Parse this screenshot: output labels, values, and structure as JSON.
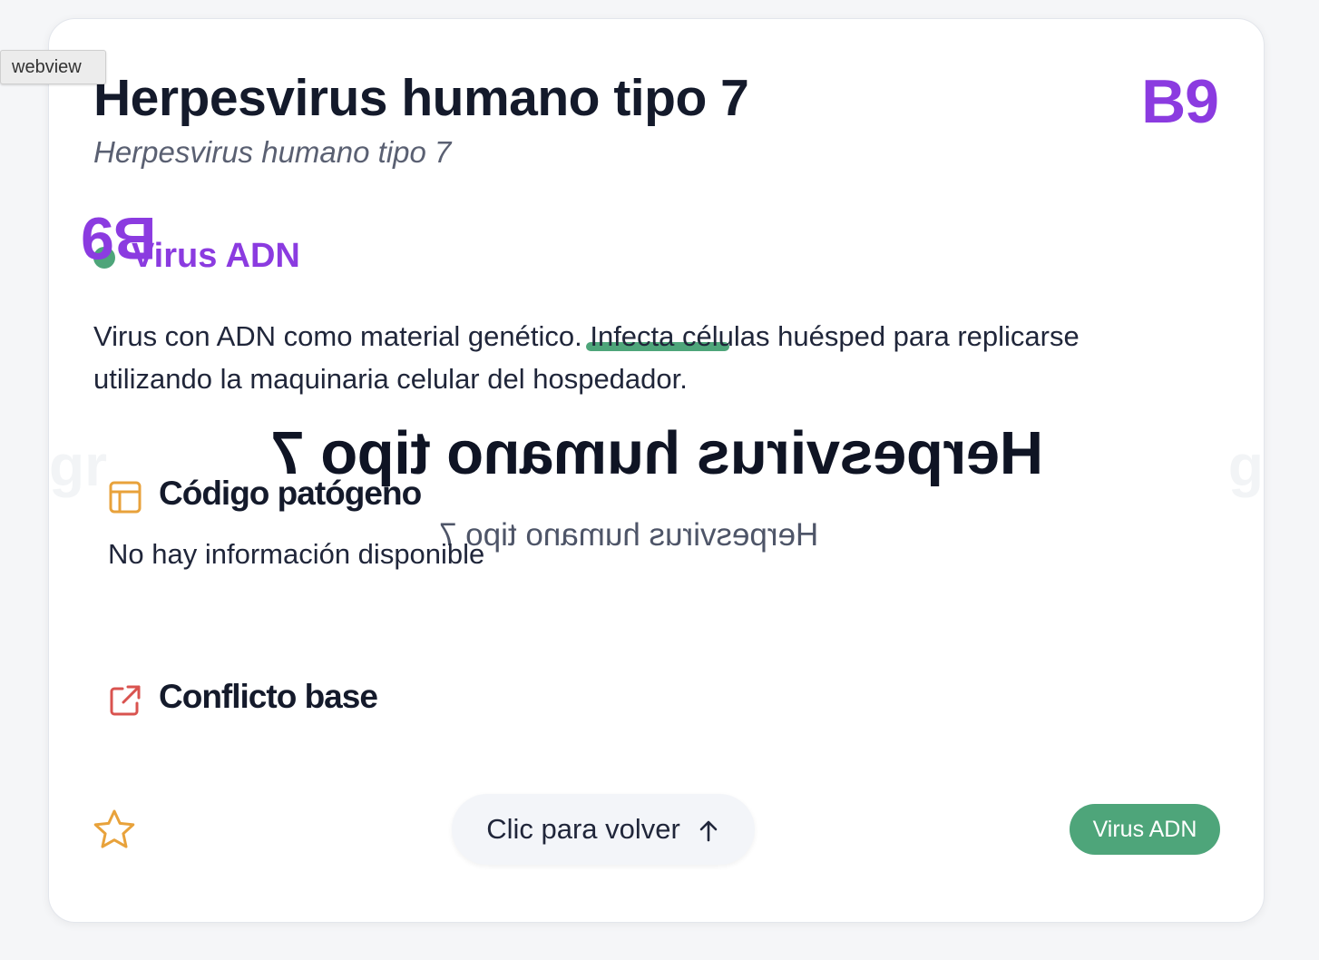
{
  "webview_label": "webview",
  "card": {
    "title": "Herpesvirus humano tipo 7",
    "subtitle": "Herpesvirus humano tipo 7",
    "code": "B9",
    "category": "Virus ADN",
    "description": "Virus con ADN como material genético. Infecta células huésped para replicarse utilizando la maquinaria celular del hospedador.",
    "sections": [
      {
        "title": "Código patógeno",
        "body": "No hay información disponible",
        "icon": "table-icon",
        "color": "#e8a23b"
      },
      {
        "title": "Conflicto base",
        "body": "",
        "icon": "external-link-icon",
        "color": "#d9534f"
      }
    ],
    "back_label": "Clic para volver",
    "tag": "Virus ADN",
    "favorite_icon": "star-icon"
  },
  "colors": {
    "accent": "#8b3be0",
    "green": "#4ea57a",
    "star": "#e8a23b"
  }
}
